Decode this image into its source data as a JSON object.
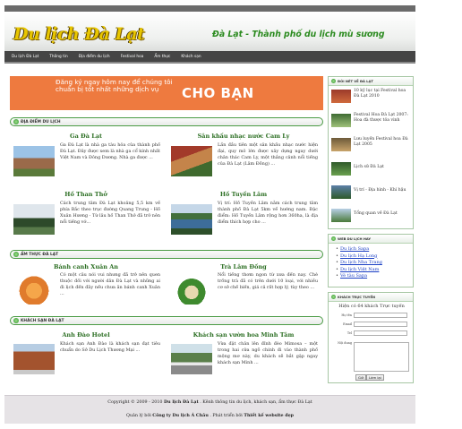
{
  "header": {
    "logo_text": "Du lịch Đà Lạt",
    "slogan": "Đà Lạt - Thành phố du lịch mù sương"
  },
  "nav": {
    "items": [
      "Du lịch Đà Lạt",
      "Thông tin",
      "Địa điểm du lịch",
      "Festival hoa",
      "Ẩm thực",
      "Khách sạn"
    ]
  },
  "banner": {
    "text": "Đăng ký ngay hôm nay để chúng tôi chuẩn bị tốt nhất những dịch vụ",
    "big_text": "CHO BẠN"
  },
  "sections": [
    {
      "title": "ĐỊA ĐIỂM DU LỊCH",
      "items": [
        {
          "title": "Ga Đà Lạt",
          "desc": "Ga Đà Lạt là nhà ga tàu hỏa của thành phố Đà Lạt. Đây được xem là nhà ga cổ kính nhất Việt Nam và Đông Dương. Nhà ga được ..."
        },
        {
          "title": "Sân khấu nhạc nước Cam Ly",
          "desc": "Lần đầu tiên một sân khấu nhạc nước hiện đại, quy mô lớn được xây dựng ngay dưới chân thác Cam Ly, một thắng cảnh nổi tiếng của Đà Lạt (Lâm Đồng) ..."
        },
        {
          "title": "Hồ Than Thở",
          "desc": "Cách trung tâm Đà Lạt khoảng 5,5 km về phía Bắc theo trục đường Quang Trung - Hồ Xuân Hương - Từ lâu hồ Than Thở đã trở nên nổi tiếng vớ..."
        },
        {
          "title": "Hồ Tuyền Lâm",
          "desc": "Vị trí: Hồ Tuyền Lâm nằm cách trung tâm thành phố Đà Lạt 5km về hướng nam. Đặc điểm: Hồ Tuyền Lâm rộng hơn 360ha, là địa điểm thích hợp cho ..."
        }
      ]
    },
    {
      "title": "ẨM THỰC ĐÀ LẠT",
      "items": [
        {
          "title": "Bánh canh Xuân An",
          "desc": "Có một câu nói vui nhưng đã trở nên quen thuộc đối với người dân Đà Lạt và những ai đi lịch đến đây nếu chưa ăn bánh canh Xuân ..."
        },
        {
          "title": "Trà Lâm Đồng",
          "desc": "Nổi tiếng thơm ngon từ xưa đến nay. Chè trồng trà đã có trên dưới 10 loại, với nhiều cơ sở chế biến, giá cả rất hợp lý, tùy theo ..."
        }
      ]
    },
    {
      "title": "KHÁCH SẠN ĐÀ LẠT",
      "items": [
        {
          "title": "Anh Đào Hotel",
          "desc": "Khách sạn Anh Đào là khách sạn đạt tiêu chuẩn do Sở Du Lịch Thương Mại ..."
        },
        {
          "title": "Khách sạn vườn hoa Minh Tâm",
          "desc": "Vừa đặt chân lên đỉnh đèo Mimosa – một trong hai cửa ngõ chính đi vào thành phố mộng mơ này, du khách sẽ bắt gặp ngay khách sạn Minh ..."
        }
      ]
    }
  ],
  "footer": {
    "line1_prefix": "Copyright © 2009 - 2010 ",
    "line1_brand": "Du lịch Đà Lạt",
    "line1_suffix": " . Kênh thông tin du lịch, khách sạn, ẩm thực Đà Lạt",
    "line2_prefix": "Quản lý bởi ",
    "line2_company": "Công ty Du lịch Á Châu",
    "line2_mid": " . Phát triển bởi ",
    "line2_dev": "Thiết kế website đẹp"
  },
  "sidebar": {
    "news": {
      "title": "ĐÔI NÉT VỀ ĐÀ LẠT",
      "items": [
        "10 kỷ lục tại Festival hoa Đà Lạt 2010",
        "Festival Hoa Đà Lạt 2007: Hoa đà thược tỏa vinh",
        "Lưu luyến Festival hoa Đà Lạt 2005",
        "Lịch sử Đà Lạt",
        "Vị trí - Địa hình - Khí hậu",
        "Tổng quan về Đà Lạt"
      ]
    },
    "links": {
      "title": "WEB DU LỊCH HAY",
      "items": [
        "Du lịch Sapa",
        "Du lịch Hạ Long",
        "Du lịch Nha Trang",
        "Du lịch Việt Nam",
        "Vé tàu Sapa"
      ]
    },
    "online": {
      "title": "KHÁCH TRỰC TUYẾN",
      "counter": "Hiện có 64 khách Trực tuyến",
      "labels": [
        "Họ tên",
        "Email",
        "Tel",
        "Nội dung"
      ],
      "buttons": [
        "Gửi",
        "Làm lại"
      ]
    }
  }
}
